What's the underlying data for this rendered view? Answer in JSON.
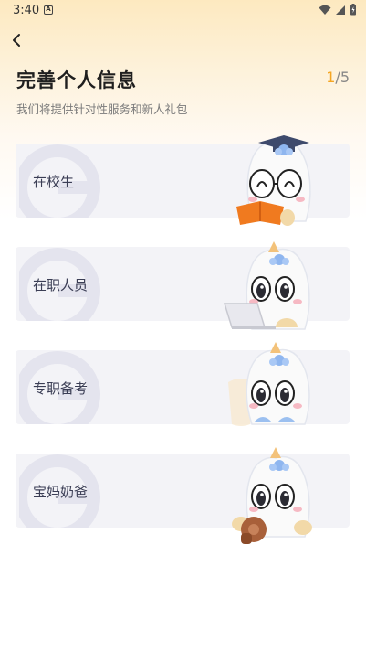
{
  "status": {
    "time": "3:40",
    "notif": "A"
  },
  "header": {
    "title": "完善个人信息",
    "subtitle": "我们将提供针对性服务和新人礼包",
    "page_current": "1",
    "page_total": "/5"
  },
  "options": [
    {
      "label": "在校生",
      "mascot": "student-mascot-icon"
    },
    {
      "label": "在职人员",
      "mascot": "worker-mascot-icon"
    },
    {
      "label": "专职备考",
      "mascot": "exam-mascot-icon"
    },
    {
      "label": "宝妈奶爸",
      "mascot": "parent-mascot-icon"
    }
  ],
  "colors": {
    "accent": "#f5a623",
    "card_bg": "#f3f3f7",
    "label": "#3b3e55"
  }
}
